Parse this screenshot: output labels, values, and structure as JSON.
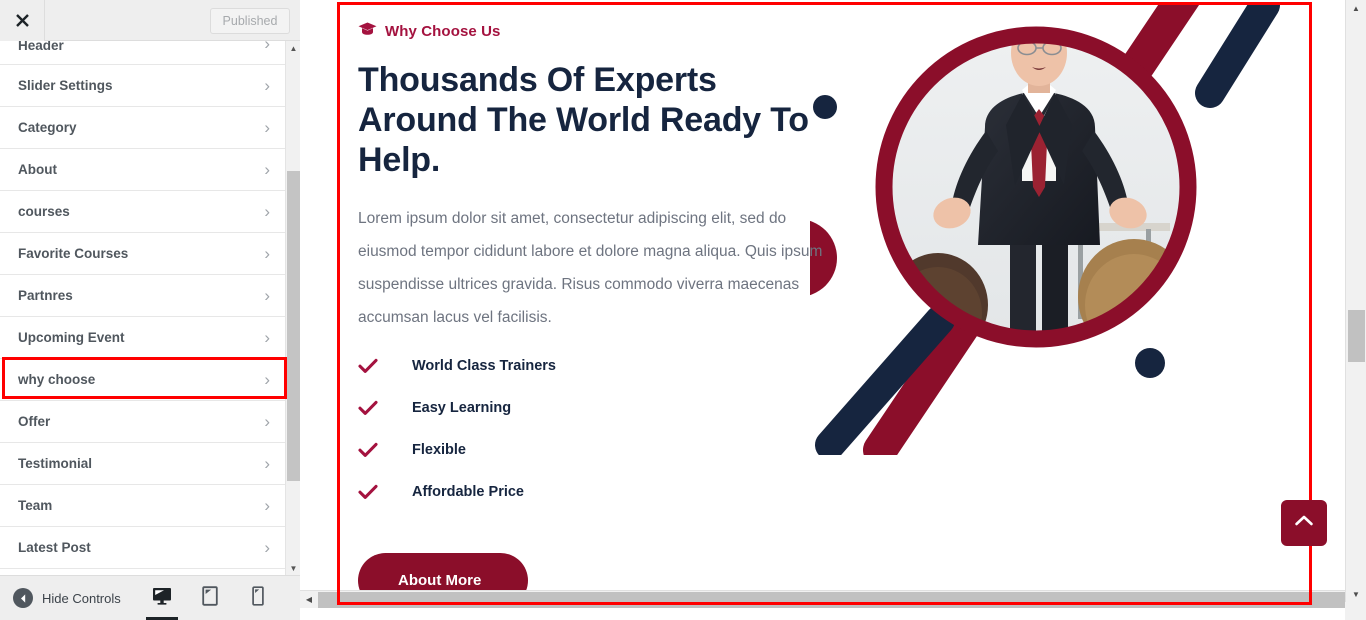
{
  "customizer": {
    "close_label": "Close",
    "publish_label": "Published",
    "sections": [
      {
        "label": "Header",
        "partial": true,
        "highlighted": false
      },
      {
        "label": "Slider Settings",
        "partial": false,
        "highlighted": false
      },
      {
        "label": "Category",
        "partial": false,
        "highlighted": false
      },
      {
        "label": "About",
        "partial": false,
        "highlighted": false
      },
      {
        "label": "courses",
        "partial": false,
        "highlighted": false
      },
      {
        "label": "Favorite Courses",
        "partial": false,
        "highlighted": false
      },
      {
        "label": "Partnres",
        "partial": false,
        "highlighted": false
      },
      {
        "label": "Upcoming Event",
        "partial": false,
        "highlighted": false
      },
      {
        "label": "why choose",
        "partial": false,
        "highlighted": true
      },
      {
        "label": "Offer",
        "partial": false,
        "highlighted": false
      },
      {
        "label": "Testimonial",
        "partial": false,
        "highlighted": false
      },
      {
        "label": "Team",
        "partial": false,
        "highlighted": false
      },
      {
        "label": "Latest Post",
        "partial": false,
        "highlighted": false
      }
    ],
    "chevron": "›",
    "footer": {
      "hide_controls_label": "Hide Controls",
      "devices": [
        {
          "name": "desktop",
          "active": true
        },
        {
          "name": "tablet",
          "active": false
        },
        {
          "name": "mobile",
          "active": false
        }
      ]
    },
    "highlight_color": "#ff0000"
  },
  "preview": {
    "section": {
      "eyebrow": "Why Choose Us",
      "eyebrow_icon": "graduation-cap-icon",
      "headline": "Thousands Of Experts Around The World Ready To Help.",
      "body": "Lorem ipsum dolor sit amet, consectetur adipiscing elit, sed do eiusmod tempor cididunt labore et dolore magna aliqua. Quis ipsum suspendisse ultrices gravida. Risus commodo viverra maecenas accumsan lacus vel facilisis.",
      "features": [
        "World Class Trainers",
        "Easy Learning",
        "Flexible",
        "Affordable Price"
      ],
      "cta_label": "About More",
      "image_alt": "Man in dark suit with red tie speaking to an audience"
    },
    "scroll_top_icon": "chevron-up-icon",
    "colors": {
      "brand_red": "#8b0e2a",
      "accent_crimson": "#a4123f",
      "navy": "#16253f",
      "body_text": "#6e7480",
      "selection_outline": "#ff0000"
    }
  }
}
